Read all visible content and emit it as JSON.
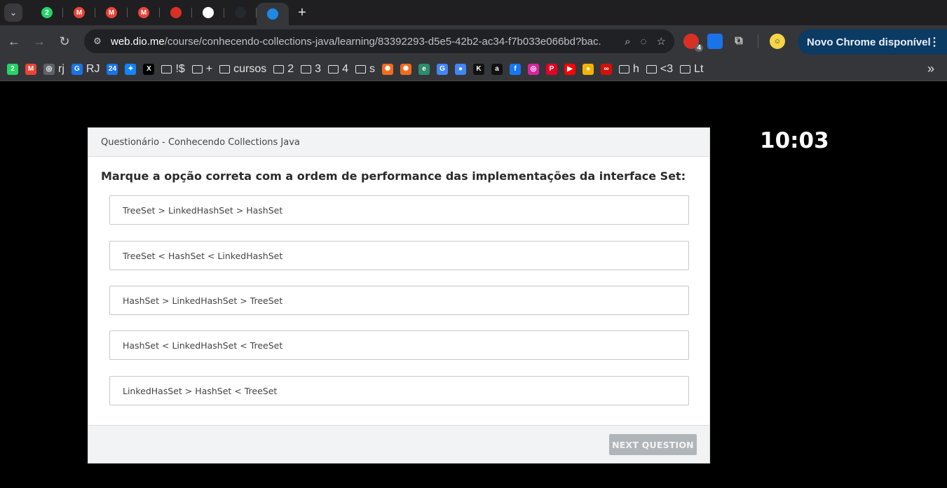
{
  "browser": {
    "tabs": [
      {
        "icon": "whatsapp-icon",
        "badge": "2",
        "color": "#25d366"
      },
      {
        "icon": "gmail-icon",
        "badge": "M",
        "color": "#ea4335"
      },
      {
        "icon": "gmail-icon",
        "badge": "M",
        "color": "#ea4335"
      },
      {
        "icon": "gmail-icon",
        "badge": "M",
        "color": "#ea4335"
      },
      {
        "icon": "bag-icon",
        "badge": "",
        "color": "#d93025"
      },
      {
        "icon": "chatgpt-icon",
        "badge": "",
        "color": "#ffffff"
      },
      {
        "icon": "github-icon",
        "badge": "",
        "color": "#24292e"
      },
      {
        "icon": "dio-icon",
        "badge": "",
        "color": "#1e88e5"
      }
    ],
    "new_tab_label": "+",
    "url_host": "web.dio.me",
    "url_path": "/course/conhecendo-collections-java/learning/83392293-d5e5-42b2-ac34-f7b033e066bd?bac...",
    "extension_badge": "4",
    "update_label": "Novo Chrome disponível",
    "bookmarks": [
      {
        "type": "fav",
        "label": "",
        "icon": "whatsapp-icon",
        "color": "#25d366",
        "glyph": "2"
      },
      {
        "type": "fav",
        "label": "",
        "icon": "gmail-icon",
        "color": "#ea4335",
        "glyph": "M"
      },
      {
        "type": "fav",
        "label": "rj",
        "icon": "globe-icon",
        "color": "#5f6368",
        "glyph": "◎"
      },
      {
        "type": "fav",
        "label": "RJ",
        "icon": "g-icon",
        "color": "#1a73e8",
        "glyph": "G"
      },
      {
        "type": "fav",
        "label": "",
        "icon": "calendar-icon",
        "color": "#1a73e8",
        "glyph": "24"
      },
      {
        "type": "fav",
        "label": "",
        "icon": "bluesky-icon",
        "color": "#1185fe",
        "glyph": "✦"
      },
      {
        "type": "fav",
        "label": "",
        "icon": "x-icon",
        "color": "#000000",
        "glyph": "X"
      },
      {
        "type": "folder",
        "label": "!$"
      },
      {
        "type": "folder",
        "label": "+"
      },
      {
        "type": "folder",
        "label": "cursos"
      },
      {
        "type": "folder",
        "label": "2"
      },
      {
        "type": "folder",
        "label": "3"
      },
      {
        "type": "folder",
        "label": "4"
      },
      {
        "type": "folder",
        "label": "s"
      },
      {
        "type": "fav",
        "label": "",
        "icon": "sun-icon",
        "color": "#f26b1d",
        "glyph": "✺"
      },
      {
        "type": "fav",
        "label": "",
        "icon": "sun-icon",
        "color": "#f26b1d",
        "glyph": "✺"
      },
      {
        "type": "fav",
        "label": "",
        "icon": "edge-icon",
        "color": "#2c8c6c",
        "glyph": "e"
      },
      {
        "type": "fav",
        "label": "",
        "icon": "translate-icon",
        "color": "#4285f4",
        "glyph": "G"
      },
      {
        "type": "fav",
        "label": "",
        "icon": "assistant-icon",
        "color": "#4285f4",
        "glyph": "●"
      },
      {
        "type": "fav",
        "label": "",
        "icon": "k-icon",
        "color": "#111111",
        "glyph": "K"
      },
      {
        "type": "fav",
        "label": "",
        "icon": "amazon-icon",
        "color": "#111111",
        "glyph": "a"
      },
      {
        "type": "fav",
        "label": "",
        "icon": "facebook-icon",
        "color": "#1877f2",
        "glyph": "f"
      },
      {
        "type": "fav",
        "label": "",
        "icon": "instagram-icon",
        "color": "#d6249f",
        "glyph": "◎"
      },
      {
        "type": "fav",
        "label": "",
        "icon": "pinterest-icon",
        "color": "#e60023",
        "glyph": "P"
      },
      {
        "type": "fav",
        "label": "",
        "icon": "youtube-icon",
        "color": "#ff0000",
        "glyph": "▶"
      },
      {
        "type": "fav",
        "label": "",
        "icon": "chrome-color-icon",
        "color": "#f4b400",
        "glyph": "●"
      },
      {
        "type": "fav",
        "label": "",
        "icon": "lastfm-icon",
        "color": "#d51007",
        "glyph": "∞"
      },
      {
        "type": "folder",
        "label": "h"
      },
      {
        "type": "folder",
        "label": "<3"
      },
      {
        "type": "folder",
        "label": "Lt"
      }
    ],
    "more_bookmarks": "»"
  },
  "quiz": {
    "header": "Questionário - Conhecendo Collections Java",
    "question": "Marque a opção correta com a ordem de performance das implementações da interface Set:",
    "options": [
      "TreeSet > LinkedHashSet > HashSet",
      "TreeSet < HashSet < LinkedHashSet",
      "HashSet > LinkedHashSet > TreeSet",
      "HashSet < LinkedHashSet < TreeSet",
      "LinkedHasSet > HashSet < TreeSet"
    ],
    "next_button": "NEXT QUESTION"
  },
  "timer": "10:03"
}
